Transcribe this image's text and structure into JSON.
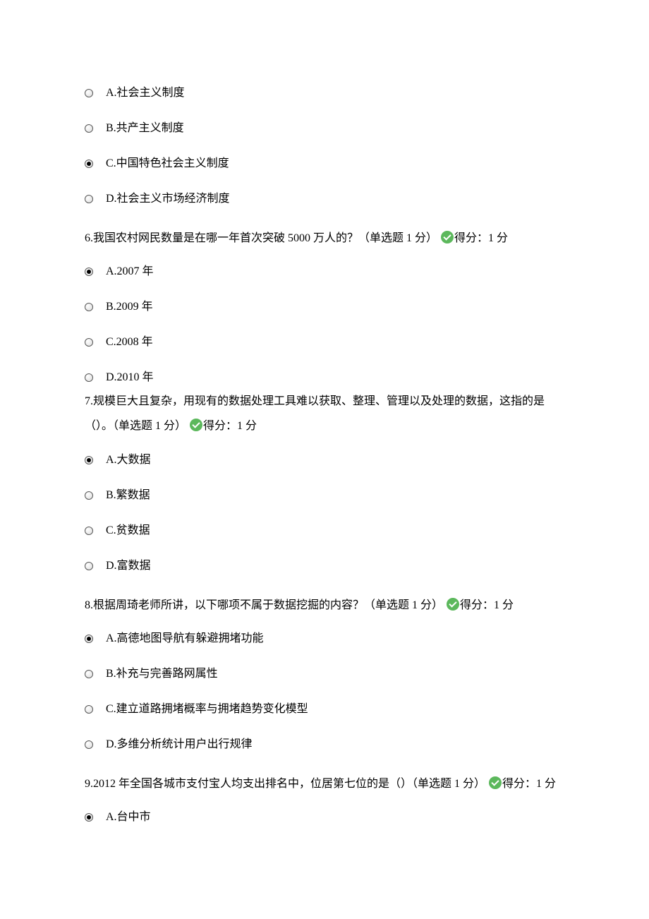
{
  "q5": {
    "options": [
      {
        "label": "A.社会主义制度",
        "selected": false
      },
      {
        "label": "B.共产主义制度",
        "selected": false
      },
      {
        "label": "C.中国特色社会主义制度",
        "selected": true
      },
      {
        "label": "D.社会主义市场经济制度",
        "selected": false
      }
    ]
  },
  "q6": {
    "text_pre": "6.我国农村网民数量是在哪一年首次突破 5000 万人的？（单选题 1 分）",
    "score": "得分：1 分",
    "options": [
      {
        "label": "A.2007 年",
        "selected": true
      },
      {
        "label": "B.2009 年",
        "selected": false
      },
      {
        "label": "C.2008 年",
        "selected": false
      },
      {
        "label": "D.2010 年",
        "selected": false
      }
    ]
  },
  "q7": {
    "text_pre": "7.规模巨大且复杂，用现有的数据处理工具难以获取、整理、管理以及处理的数据，这指的是（）。（单选题 1 分）",
    "score": "得分：1 分",
    "options": [
      {
        "label": "A.大数据",
        "selected": true
      },
      {
        "label": "B.繁数据",
        "selected": false
      },
      {
        "label": "C.贫数据",
        "selected": false
      },
      {
        "label": "D.富数据",
        "selected": false
      }
    ]
  },
  "q8": {
    "text_pre": "8.根据周琦老师所讲，以下哪项不属于数据挖掘的内容？（单选题 1 分）",
    "score": "得分：1 分",
    "options": [
      {
        "label": "A.高德地图导航有躲避拥堵功能",
        "selected": true
      },
      {
        "label": "B.补充与完善路网属性",
        "selected": false
      },
      {
        "label": "C.建立道路拥堵概率与拥堵趋势变化模型",
        "selected": false
      },
      {
        "label": "D.多维分析统计用户出行规律",
        "selected": false
      }
    ]
  },
  "q9": {
    "text_pre": "9.2012 年全国各城市支付宝人均支出排名中，位居第七位的是（）（单选题 1 分）",
    "score": "得分：1 分",
    "options": [
      {
        "label": "A.台中市",
        "selected": true
      }
    ]
  }
}
